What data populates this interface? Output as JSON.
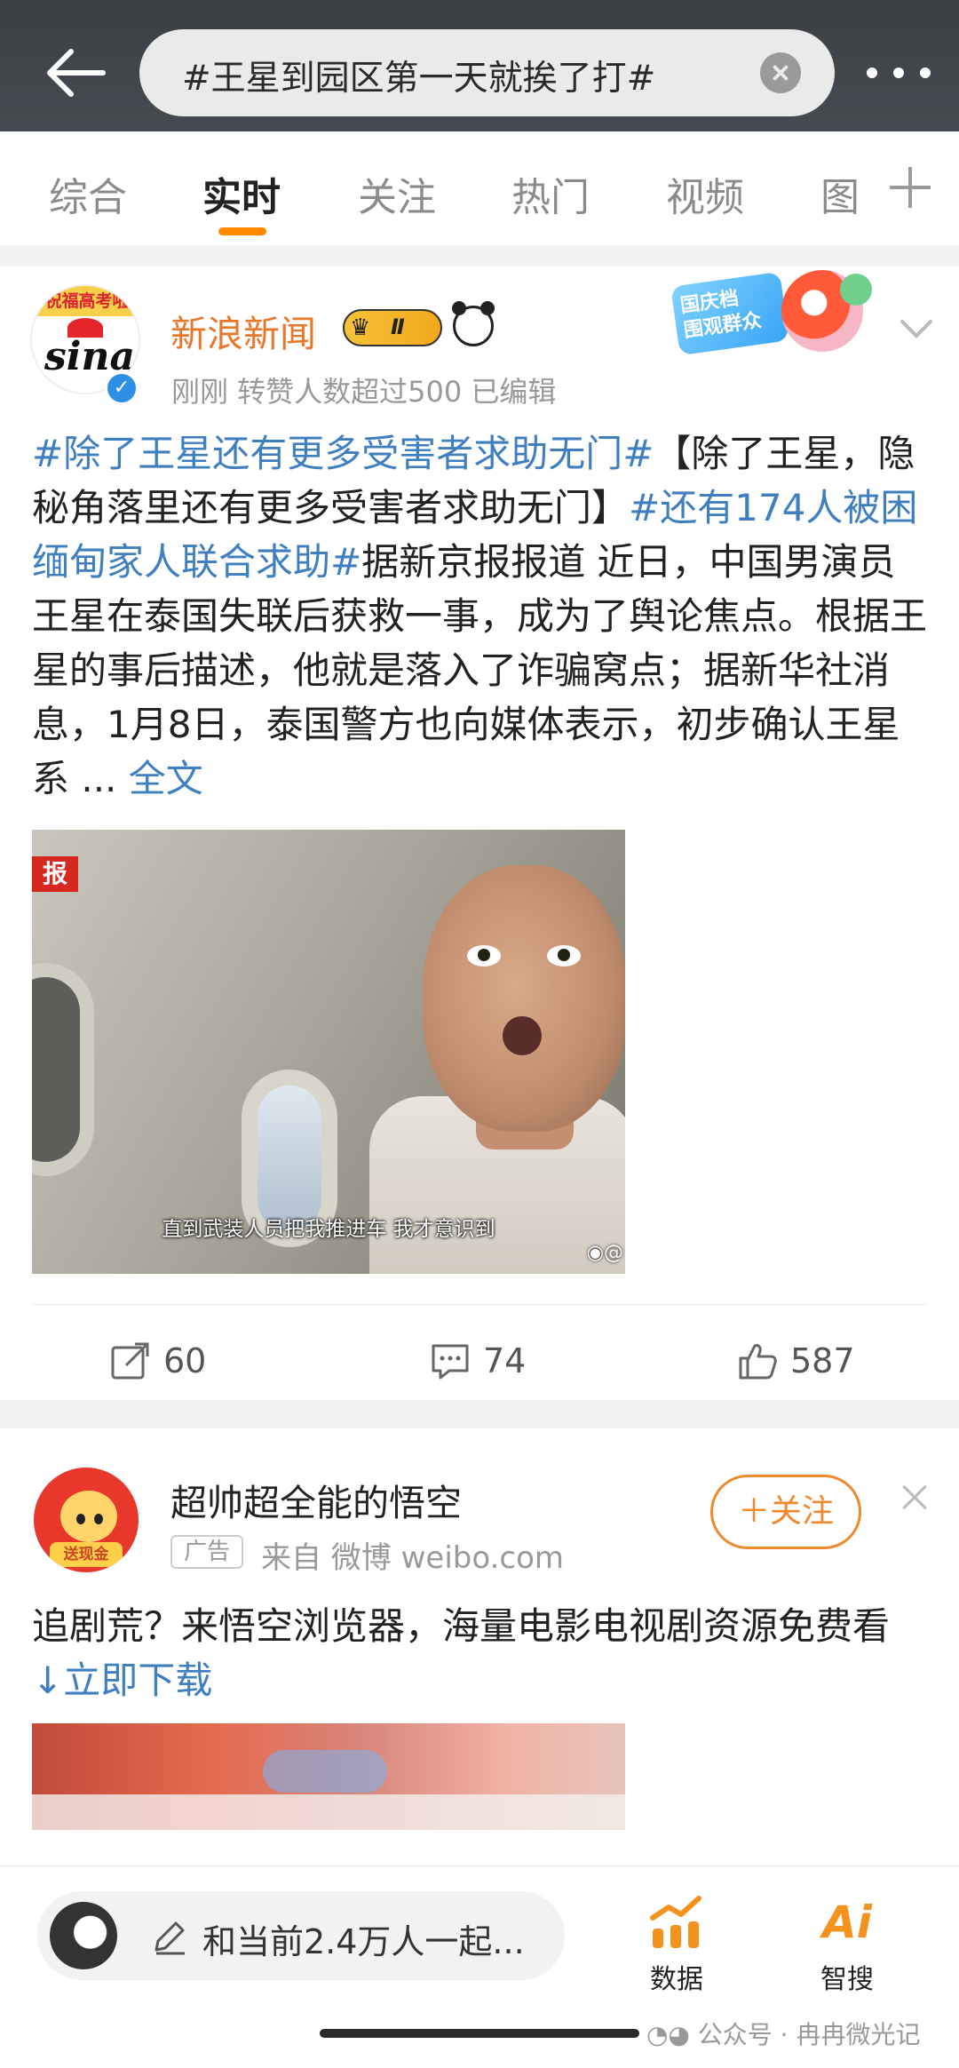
{
  "header": {
    "search_query": "#王星到园区第一天就挨了打#"
  },
  "tabs": [
    {
      "label": "综合",
      "active": false
    },
    {
      "label": "实时",
      "active": true
    },
    {
      "label": "关注",
      "active": false
    },
    {
      "label": "热门",
      "active": false
    },
    {
      "label": "视频",
      "active": false
    },
    {
      "label": "图",
      "active": false
    }
  ],
  "post": {
    "avatar_ring_text": "祝福高考啦",
    "avatar_logo_text": "sina",
    "username": "新浪新闻",
    "vip_rank": "Ⅱ",
    "meta": "刚刚  转赞人数超过500   已编辑",
    "promo_text": "国庆档\n围观群众",
    "tag1": "#除了王星还有更多受害者求助无门#",
    "text1": "【除了王星，隐秘角落里还有更多受害者求助无门】",
    "tag2": "#还有174人被困缅甸家人联合求助#",
    "text2": "据新京报报道 近日，中国男演员王星在泰国失联后获救一事，成为了舆论焦点。根据王星的事后描述，他就是落入了诈骗窝点；据新华社消息，1月8日，泰国警方也向媒体表示，初步确认王星系 ... ",
    "expand_label": "全文",
    "video_badge": "报",
    "video_subtitle": "直到武装人员把我推进车 我才意识到",
    "video_watermark": "@",
    "reposts": "60",
    "comments": "74",
    "likes": "587"
  },
  "ad": {
    "avatar_ribbon": "送现金",
    "name": "超帅超全能的悟空",
    "badge": "广告",
    "source": "来自 微博 weibo.com",
    "follow_label": "＋关注",
    "text": "追剧荒？来悟空浏览器，海量电影电视剧资源免费看 ",
    "link_label": "↓立即下载"
  },
  "bottom_bar": {
    "comment_placeholder": "和当前2.4万人一起...",
    "data_label": "数据",
    "ai_icon_text": "Ai",
    "ai_label": "智搜",
    "watermark": "公众号 · 冉冉微光记"
  },
  "colors": {
    "accent": "#ff8a00",
    "username": "#e8762b",
    "link": "#3f7fbf"
  }
}
